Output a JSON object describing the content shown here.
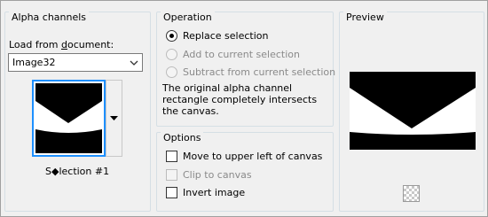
{
  "alpha_channels": {
    "title": "Alpha channels",
    "load_label": "Load from document:",
    "load_underline": "d",
    "document_select": "Image32",
    "selection_name": "S◆lection #1"
  },
  "operation": {
    "title": "Operation",
    "replace": {
      "label": "Replace selection",
      "checked": true,
      "enabled": true
    },
    "add": {
      "label": "Add to current selection",
      "checked": false,
      "enabled": false
    },
    "subtract": {
      "label": "Subtract from current selection",
      "checked": false,
      "enabled": false
    },
    "info": "The original alpha channel rectangle completely intersects the canvas."
  },
  "options": {
    "title": "Options",
    "move": {
      "label": "Move to upper left of canvas",
      "checked": false,
      "enabled": true
    },
    "clip": {
      "label": "Clip to canvas",
      "checked": false,
      "enabled": false
    },
    "invert": {
      "label": "Invert image",
      "checked": false,
      "enabled": true
    }
  },
  "preview": {
    "title": "Preview",
    "background_icon": "checkerboard-icon"
  },
  "colors": {
    "accent": "#1e90ff",
    "window_bg": "#f0f0f0",
    "group_border": "#d5dfe5"
  }
}
